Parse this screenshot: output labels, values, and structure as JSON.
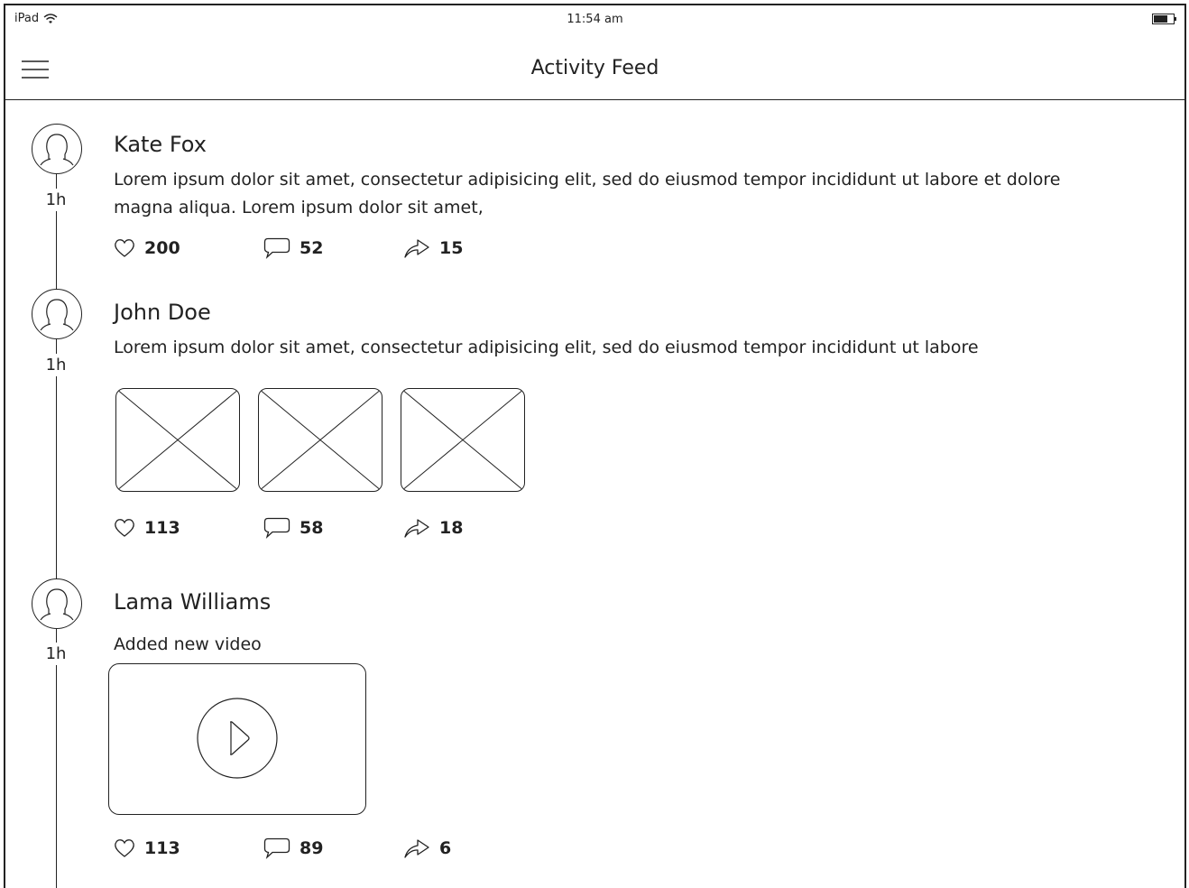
{
  "status_bar": {
    "device": "iPad",
    "time": "11:54 am",
    "icons": [
      "wifi-icon",
      "battery-icon"
    ]
  },
  "header": {
    "title": "Activity Feed",
    "menu_icon": "hamburger-menu-icon"
  },
  "feed": [
    {
      "name": "Kate Fox",
      "time": "1h",
      "text": "Lorem ipsum dolor sit amet, consectetur adipisicing elit, sed do eiusmod tempor incididunt ut labore et dolore magna aliqua. Lorem ipsum dolor sit amet,",
      "likes": "200",
      "comments": "52",
      "shares": "15"
    },
    {
      "name": "John Doe",
      "time": "1h",
      "text": "Lorem ipsum dolor sit amet, consectetur adipisicing elit, sed do eiusmod tempor incididunt ut labore",
      "image_count": 3,
      "likes": "113",
      "comments": "58",
      "shares": "18"
    },
    {
      "name": "Lama Williams",
      "time": "1h",
      "text": "Added new video",
      "likes": "113",
      "comments": "89",
      "shares": "6"
    }
  ]
}
